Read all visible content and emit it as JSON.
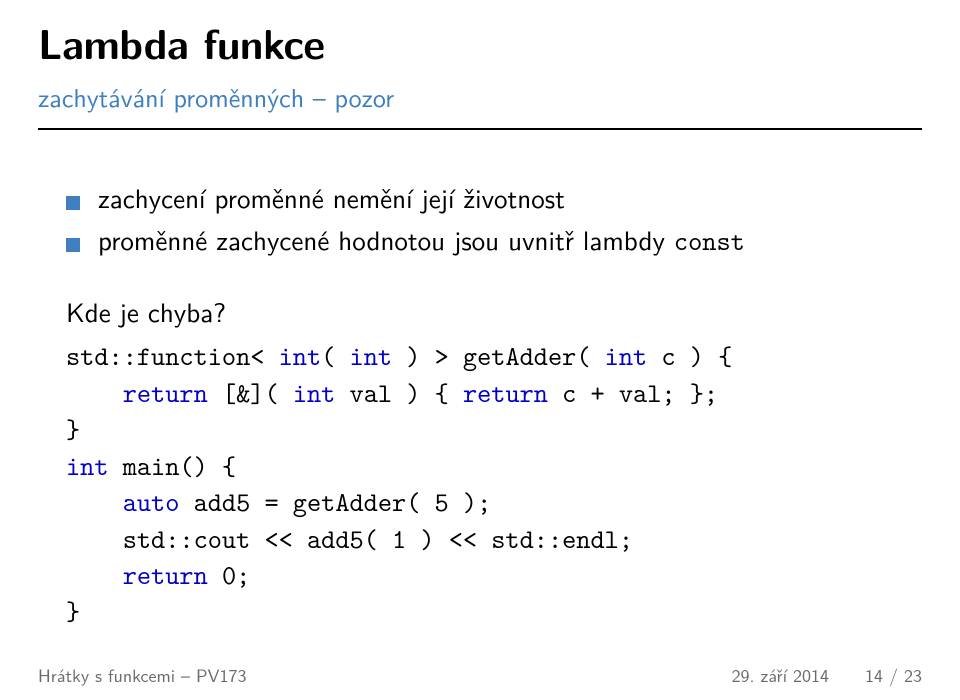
{
  "header": {
    "title": "Lambda funkce",
    "subtitle": "zachytávání proměnných – pozor"
  },
  "bullets": [
    "zachycení proměnné nemění její životnost",
    [
      "proměnné zachycené hodnotou jsou uvnitř lambdy ",
      "const"
    ]
  ],
  "where_label": "Kde je chyba?",
  "code": {
    "l1a": "std::function< ",
    "l1b": "int",
    "l1c": "( ",
    "l1d": "int",
    "l1e": " ) > getAdder( ",
    "l1f": "int",
    "l1g": " c ) {",
    "l2a": "    ",
    "l2b": "return",
    "l2c": " [&]( ",
    "l2d": "int",
    "l2e": " val ) { ",
    "l2f": "return",
    "l2g": " c + val; };",
    "l3": "}",
    "l4a": "int",
    "l4b": " main() {",
    "l5a": "    ",
    "l5b": "auto",
    "l5c": " add5 = getAdder( 5 );",
    "l6": "    std::cout << add5( 1 ) << std::endl;",
    "l7a": "    ",
    "l7b": "return",
    "l7c": " 0;",
    "l8": "}"
  },
  "footer": {
    "left": "Hrátky s funkcemi – PV173",
    "right_date": "29. září 2014",
    "right_page": "14 / 23"
  }
}
